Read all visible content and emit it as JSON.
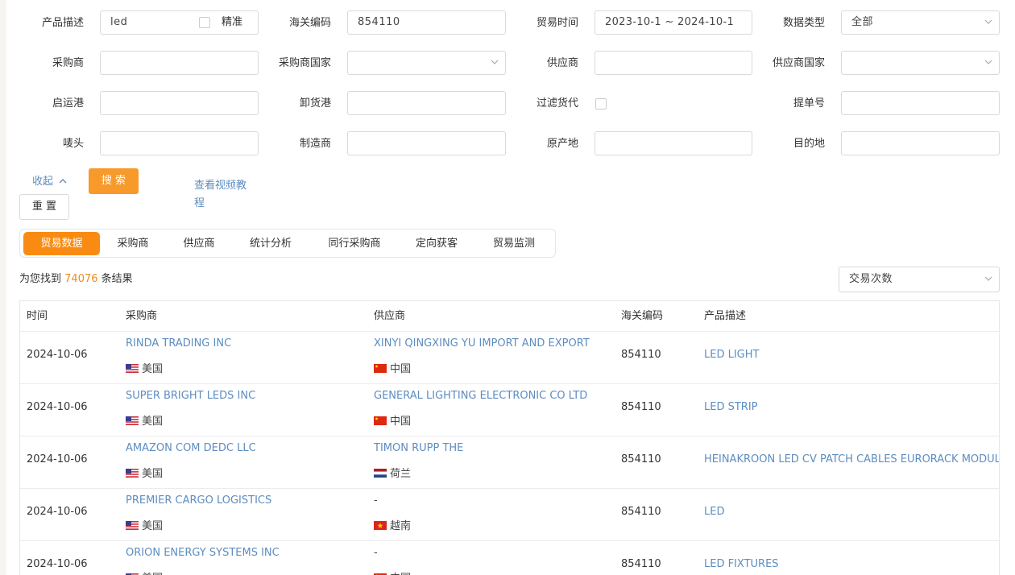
{
  "filters": {
    "product_desc": {
      "label": "产品描述",
      "value": "led",
      "exact_label": "精准"
    },
    "hs_code": {
      "label": "海关编码",
      "value": "854110"
    },
    "trade_time": {
      "label": "贸易时间",
      "value": "2023-10-1 ~ 2024-10-1"
    },
    "data_type": {
      "label": "数据类型",
      "value": "全部"
    },
    "buyer": {
      "label": "采购商",
      "value": ""
    },
    "buyer_country": {
      "label": "采购商国家",
      "value": ""
    },
    "supplier": {
      "label": "供应商",
      "value": ""
    },
    "supplier_country": {
      "label": "供应商国家",
      "value": ""
    },
    "origin_port": {
      "label": "启运港",
      "value": ""
    },
    "unload_port": {
      "label": "卸货港",
      "value": ""
    },
    "filter_forwarder": {
      "label": "过滤货代"
    },
    "bill_no": {
      "label": "提单号",
      "value": ""
    },
    "shipping_mark": {
      "label": "唛头",
      "value": ""
    },
    "manufacturer": {
      "label": "制造商",
      "value": ""
    },
    "origin": {
      "label": "原产地",
      "value": ""
    },
    "destination": {
      "label": "目的地",
      "value": ""
    }
  },
  "actions": {
    "collapse": "收起",
    "search": "搜 索",
    "reset": "重 置",
    "video_tutorial_line1": "查看视频教",
    "video_tutorial_line2": "程"
  },
  "tabs": [
    "贸易数据",
    "采购商",
    "供应商",
    "统计分析",
    "同行采购商",
    "定向获客",
    "贸易监测"
  ],
  "result": {
    "prefix": "为您找到",
    "count": "74076",
    "suffix": "条结果"
  },
  "sort": {
    "value": "交易次数"
  },
  "table": {
    "columns": [
      "时间",
      "采购商",
      "供应商",
      "海关编码",
      "产品描述"
    ],
    "rows": [
      {
        "date": "2024-10-06",
        "buyer": "RINDA TRADING INC",
        "buyer_country": "美国",
        "buyer_flag": "us",
        "supplier": "XINYI QINGXING YU IMPORT AND EXPORT",
        "supplier_country": "中国",
        "supplier_flag": "cn",
        "hs": "854110",
        "desc": "LED LIGHT"
      },
      {
        "date": "2024-10-06",
        "buyer": "SUPER BRIGHT LEDS INC",
        "buyer_country": "美国",
        "buyer_flag": "us",
        "supplier": "GENERAL LIGHTING ELECTRONIC CO LTD",
        "supplier_country": "中国",
        "supplier_flag": "cn",
        "hs": "854110",
        "desc": "LED STRIP"
      },
      {
        "date": "2024-10-06",
        "buyer": "AMAZON COM DEDC LLC",
        "buyer_country": "美国",
        "buyer_flag": "us",
        "supplier": "TIMON RUPP THE",
        "supplier_country": "荷兰",
        "supplier_flag": "nl",
        "hs": "854110",
        "desc": "HEINAKROON LED CV PATCH CABLES EURORACK MODUL"
      },
      {
        "date": "2024-10-06",
        "buyer": "PREMIER CARGO LOGISTICS",
        "buyer_country": "美国",
        "buyer_flag": "us",
        "supplier": "-",
        "supplier_country": "越南",
        "supplier_flag": "vn",
        "hs": "854110",
        "desc": "LED"
      },
      {
        "date": "2024-10-06",
        "buyer": "ORION ENERGY SYSTEMS INC",
        "buyer_country": "美国",
        "buyer_flag": "us",
        "supplier": "-",
        "supplier_country": "中国",
        "supplier_flag": "cn",
        "hs": "854110",
        "desc": "LED FIXTURES"
      }
    ]
  },
  "colors": {
    "accent": "#f79a2b",
    "link": "#5d8dc0",
    "tab_active": "#f98b12"
  }
}
